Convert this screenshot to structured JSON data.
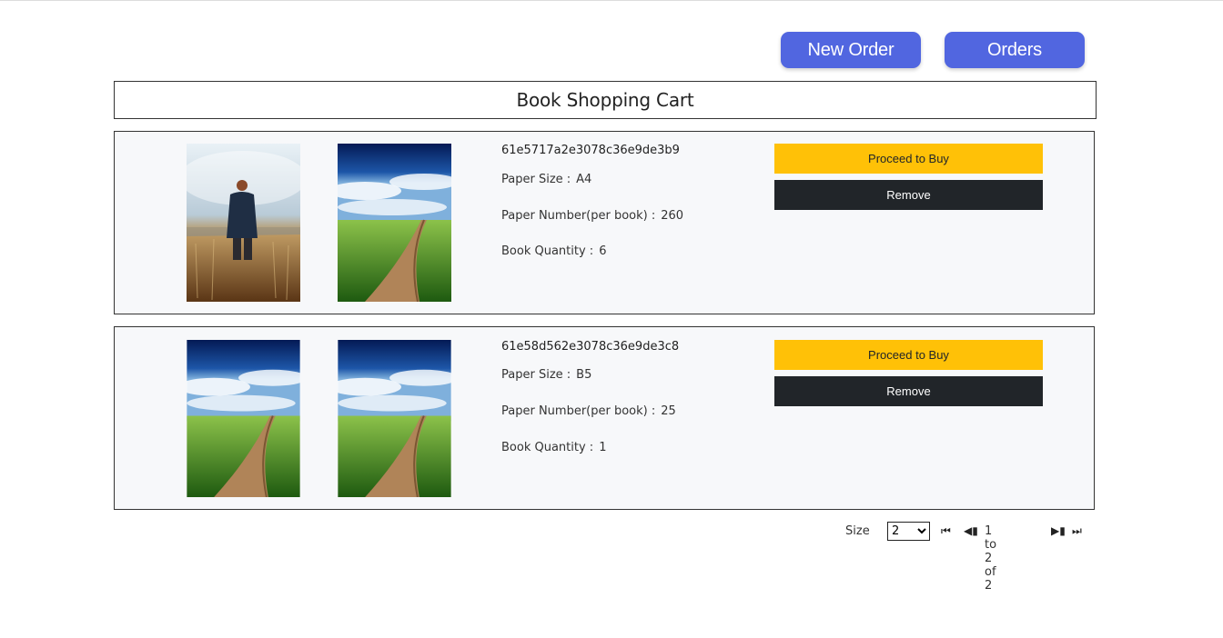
{
  "header": {
    "new_order_label": "New Order",
    "orders_label": "Orders"
  },
  "page_title": "Book Shopping Cart",
  "cart_items": [
    {
      "order_id": "61e5717a2e3078c36e9de3b9",
      "paper_size_label": "Paper Size :",
      "paper_size": "A4",
      "paper_number_label": "Paper Number(per book) :",
      "paper_number": "260",
      "quantity_label": "Book Quantity :",
      "quantity": "6",
      "images": [
        "person-in-field-photo",
        "dirt-road-field-photo"
      ],
      "buy_label": "Proceed to Buy",
      "remove_label": "Remove"
    },
    {
      "order_id": "61e58d562e3078c36e9de3c8",
      "paper_size_label": "Paper Size :",
      "paper_size": "B5",
      "paper_number_label": "Paper Number(per book) :",
      "paper_number": "25",
      "quantity_label": "Book Quantity :",
      "quantity": "1",
      "images": [
        "dirt-road-field-photo",
        "dirt-road-field-photo"
      ],
      "buy_label": "Proceed to Buy",
      "remove_label": "Remove"
    }
  ],
  "pagination": {
    "size_label": "Size",
    "size_value": "2",
    "range_text": "1 to 2 of 2",
    "icons": [
      "first-page-icon",
      "previous-page-icon",
      "next-page-icon",
      "last-page-icon"
    ]
  },
  "colors": {
    "primary": "#5166e0",
    "warning": "#ffc107",
    "dark": "#212529",
    "card_bg": "#f7f8fa"
  }
}
